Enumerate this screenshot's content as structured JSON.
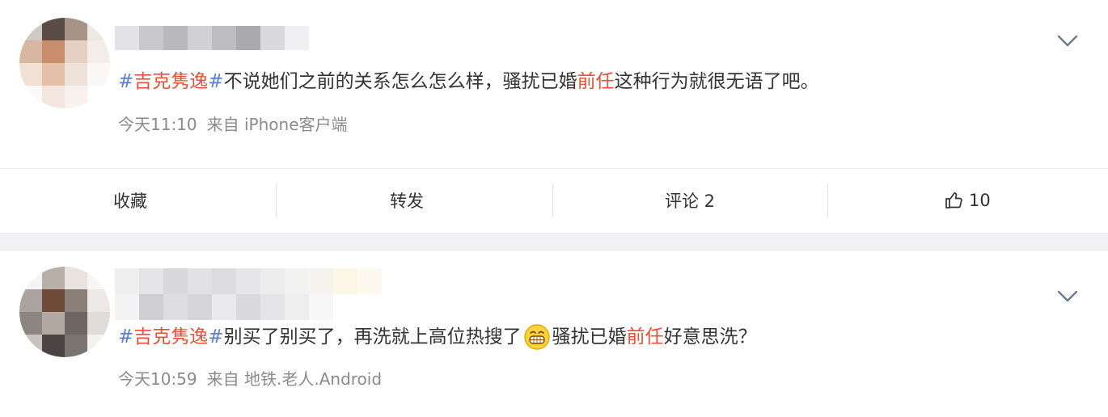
{
  "posts": [
    {
      "hashtag_text": "吉克隽逸",
      "hash_symbol": "#",
      "text_a": "不说她们之前的关系怎么怎么样，骚扰已婚",
      "keyword": "前任",
      "text_b": "这种行为就很无语了吧。",
      "time": "今天11:10",
      "source": "来自 iPhone客户端"
    },
    {
      "hashtag_text": "吉克隽逸",
      "hash_symbol": "#",
      "text_a": "别买了别买了，再洗就上高位热搜了",
      "text_a2": "骚扰已婚",
      "keyword": "前任",
      "text_b": "好意思洗？",
      "emoji_icon": "grin-emoji-icon",
      "time": "今天10:59",
      "source": "来自 地铁.老人.Android"
    }
  ],
  "actions": {
    "favorite_label": "收藏",
    "repost_label": "转发",
    "comment_label": "评论 2",
    "like_count": "10",
    "like_icon": "thumbs-up-icon"
  },
  "icons": {
    "more": "chevron-down-icon"
  },
  "colors": {
    "keyword": "#e8503a",
    "hash": "#5b7fc7",
    "meta": "#8a8a8a",
    "separator": "#f2f2f5"
  }
}
